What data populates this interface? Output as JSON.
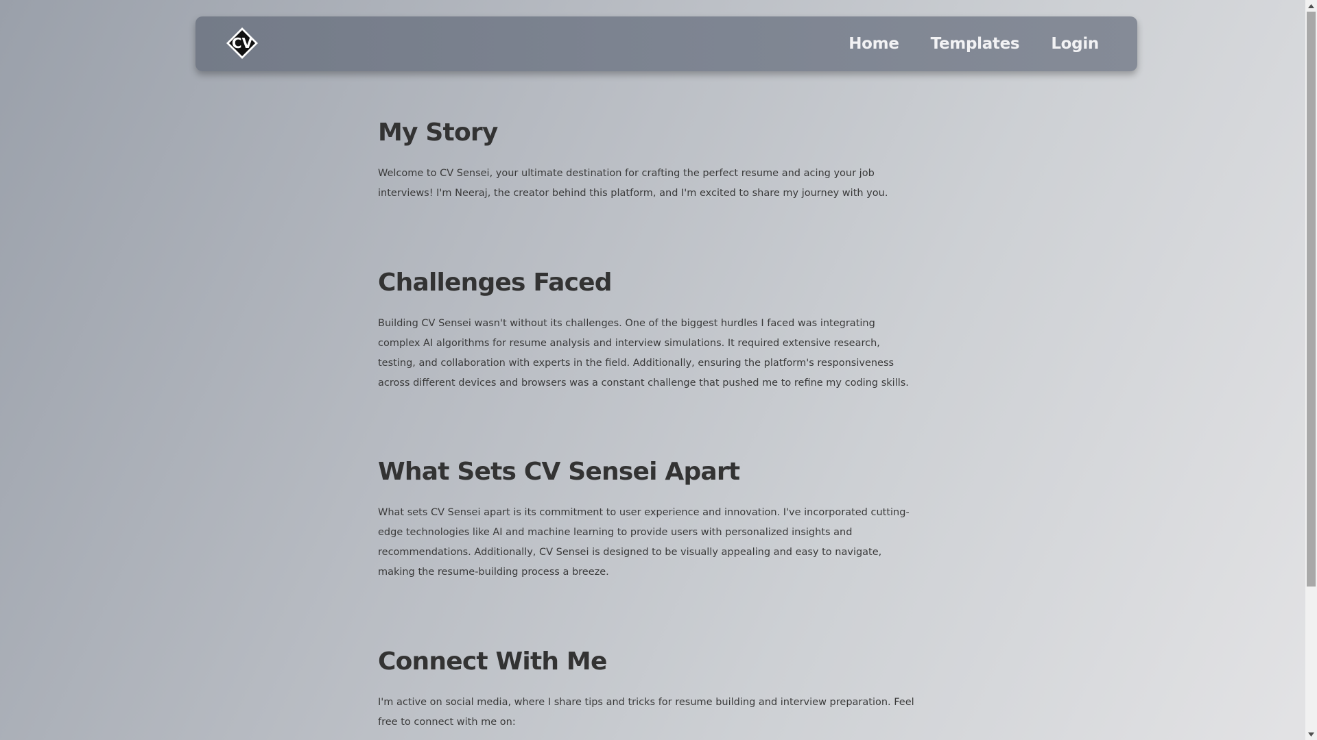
{
  "navbar": {
    "logo_text": "CV",
    "links": [
      {
        "label": "Home"
      },
      {
        "label": "Templates"
      },
      {
        "label": "Login"
      }
    ]
  },
  "sections": [
    {
      "title": "My Story",
      "text": "Welcome to CV Sensei, your ultimate destination for crafting the perfect resume and acing your job interviews! I'm Neeraj, the creator behind this platform, and I'm excited to share my journey with you."
    },
    {
      "title": "Challenges Faced",
      "text": "Building CV Sensei wasn't without its challenges. One of the biggest hurdles I faced was integrating complex AI algorithms for resume analysis and interview simulations. It required extensive research, testing, and collaboration with experts in the field. Additionally, ensuring the platform's responsiveness across different devices and browsers was a constant challenge that pushed me to refine my coding skills."
    },
    {
      "title": "What Sets CV Sensei Apart",
      "text": "What sets CV Sensei apart is its commitment to user experience and innovation. I've incorporated cutting-edge technologies like AI and machine learning to provide users with personalized insights and recommendations. Additionally, CV Sensei is designed to be visually appealing and easy to navigate, making the resume-building process a breeze."
    },
    {
      "title": "Connect With Me",
      "text": "I'm active on social media, where I share tips and tricks for resume building and interview preparation. Feel free to connect with me on:"
    }
  ],
  "colors": {
    "navbar": "#7a818d",
    "nav_text": "#f2f2f4",
    "heading": "#333333",
    "body_text": "#3a3a3a"
  },
  "icons": {
    "logo": "cv-diamond-logo-icon",
    "scroll_up": "chevron-up-icon",
    "scroll_down": "chevron-down-icon"
  }
}
